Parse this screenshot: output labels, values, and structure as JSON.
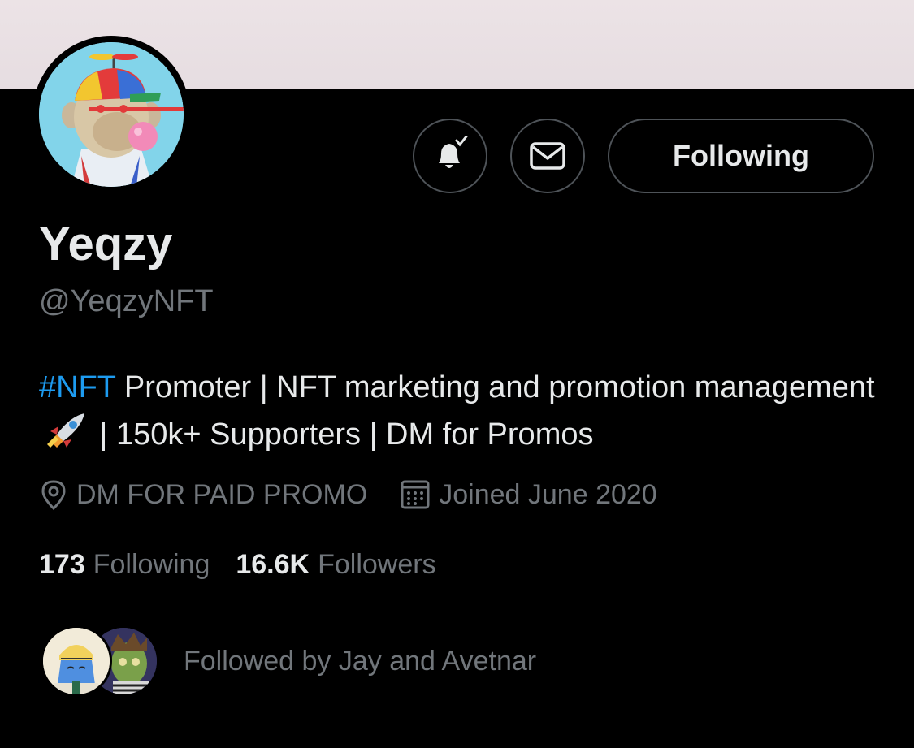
{
  "profile": {
    "display_name": "Yeqzy",
    "handle": "@YeqzyNFT",
    "bio": {
      "hashtag": "#NFT",
      "text_part1": " Promoter | NFT marketing and promotion management",
      "text_part2": " | 150k+ Supporters | DM for Promos"
    },
    "location": "DM FOR PAID PROMO",
    "joined": "Joined June 2020"
  },
  "stats": {
    "following_count": "173",
    "following_label": "Following",
    "followers_count": "16.6K",
    "followers_label": "Followers"
  },
  "actions": {
    "notify_icon": "bell-check-icon",
    "message_icon": "envelope-icon",
    "follow_label": "Following"
  },
  "followed_by": {
    "text": "Followed by Jay and Avetnar"
  },
  "colors": {
    "background": "#000000",
    "banner": "#e9e0e4",
    "link_blue": "#1d9bf0",
    "secondary_text": "#71767b",
    "primary_text": "#e7e9ea",
    "button_border": "#4e5358"
  }
}
